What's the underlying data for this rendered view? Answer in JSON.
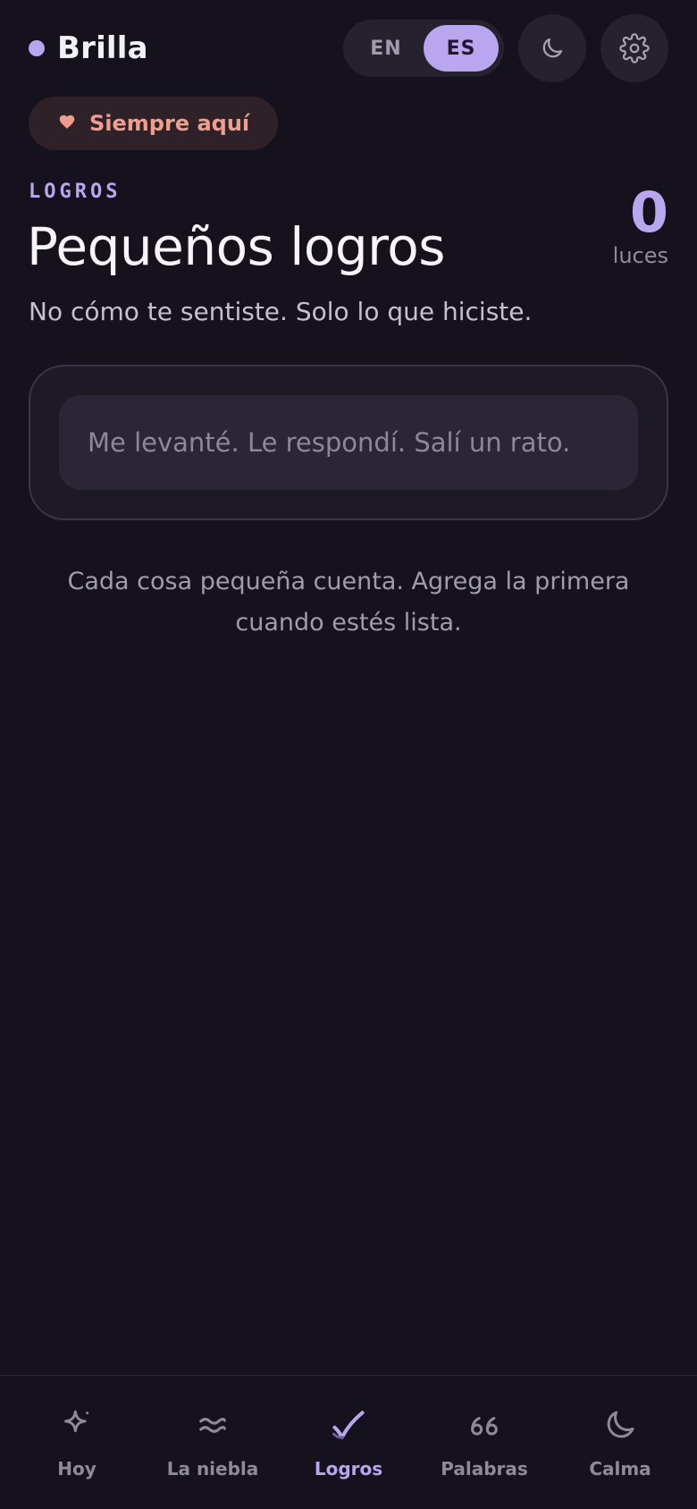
{
  "app": {
    "brand_name": "Brilla",
    "accent_color": "#b8a6ef"
  },
  "header": {
    "language_options": [
      "EN",
      "ES"
    ],
    "selected_language": "ES",
    "lang_en_label": "EN",
    "lang_es_label": "ES",
    "theme_icon": "moon-icon",
    "settings_icon": "gear-icon"
  },
  "badge": {
    "icon": "heart-icon",
    "text": "Siempre aquí",
    "color": "#ee9e8e"
  },
  "section": {
    "eyebrow": "LOGROS",
    "title": "Pequeños logros",
    "subtitle": "No cómo te sentiste. Solo lo que hiciste."
  },
  "counter": {
    "value": "0",
    "label": "luces"
  },
  "entry": {
    "value": "",
    "placeholder": "Me levanté. Le respondí. Salí un rato."
  },
  "empty_state": {
    "text": "Cada cosa pequeña cuenta. Agrega la primera cuando estés lista."
  },
  "nav": {
    "active": "Logros",
    "items": [
      {
        "icon": "sparkle-icon",
        "label": "Hoy"
      },
      {
        "icon": "waves-icon",
        "label": "La niebla"
      },
      {
        "icon": "check-icon",
        "label": "Logros"
      },
      {
        "icon": "quote-icon",
        "label": "Palabras"
      },
      {
        "icon": "moon-icon",
        "label": "Calma"
      }
    ]
  }
}
